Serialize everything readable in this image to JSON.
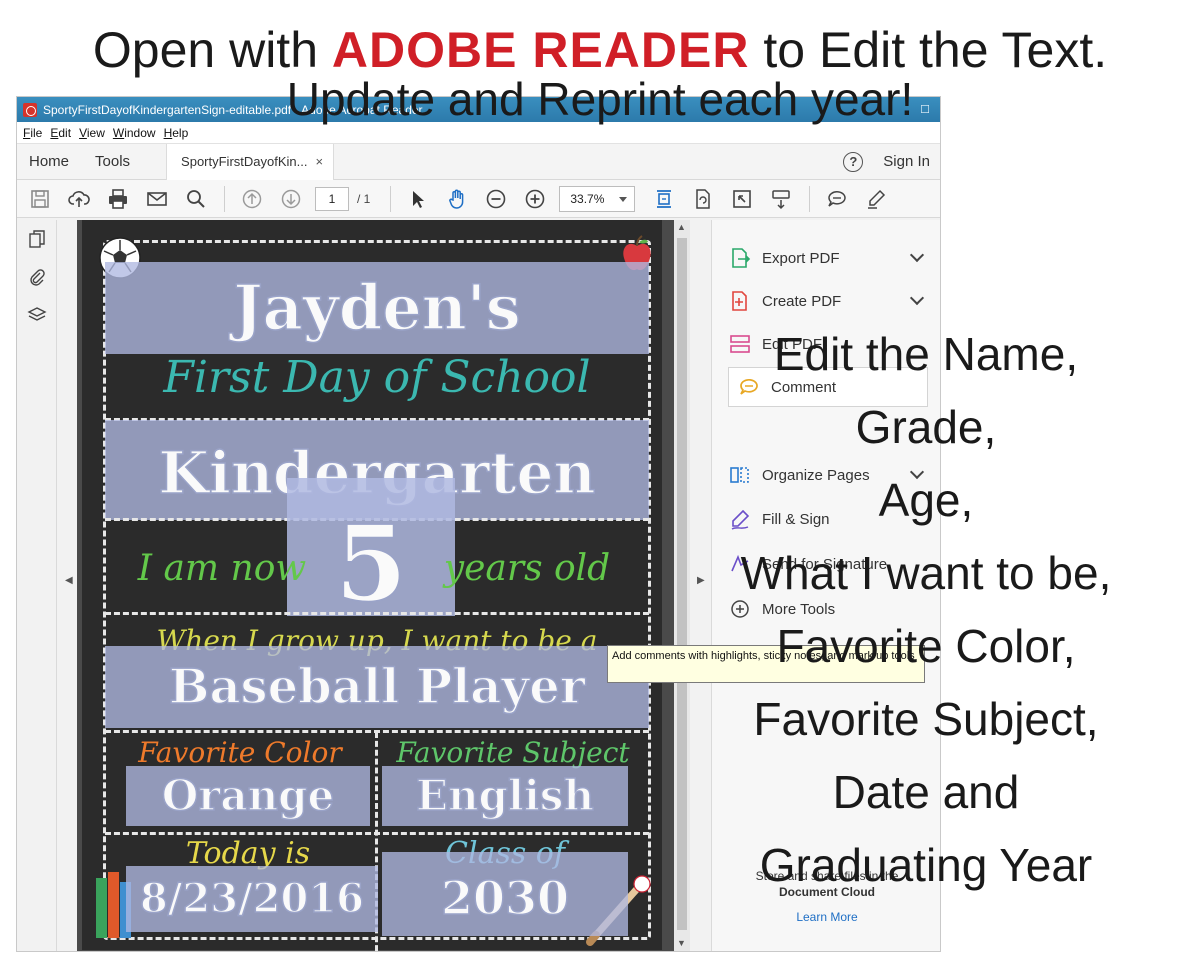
{
  "headline": {
    "line1_prefix": "Open with ",
    "line1_brand": "ADOBE READER",
    "line1_suffix": " to Edit the Text.",
    "line2": "Update and Reprint each year!"
  },
  "window": {
    "title": "SportyFirstDayofKindergartenSign-editable.pdf - Adobe Acrobat Reader",
    "menus": [
      "File",
      "Edit",
      "View",
      "Window",
      "Help"
    ],
    "nav_tabs": [
      "Home",
      "Tools"
    ],
    "doc_tab": "SportyFirstDayofKin...",
    "doc_tab_close": "×",
    "help": "?",
    "sign_in": "Sign In"
  },
  "toolbar": {
    "page_current": "1",
    "page_total": "/ 1",
    "zoom": "33.7%"
  },
  "tools_pane": {
    "items": [
      "Export PDF",
      "Create PDF",
      "Edit PDF",
      "Comment",
      "Organize Pages",
      "Fill & Sign",
      "Send for Signature",
      "More Tools"
    ],
    "tooltip": "Add comments with highlights, sticky notes, and mark up tools",
    "cloud_line1": "Store and share files in the",
    "cloud_line2": "Document Cloud",
    "learn_more": "Learn More"
  },
  "sign": {
    "name": "Jayden's",
    "subtitle": "First Day of School",
    "grade": "Kindergarten",
    "age_prefix": "I am now",
    "age": "5",
    "age_suffix": "years old",
    "grow_up_label": "When I grow up, I want to be a",
    "career": "Baseball Player",
    "color_label": "Favorite Color",
    "color_value": "Orange",
    "subject_label": "Favorite Subject",
    "subject_value": "English",
    "today_label": "Today is",
    "date": "8/23/2016",
    "class_label": "Class of",
    "class_year": "2030",
    "colors": {
      "subtitle": "#3bb8b0",
      "age_text": "#63c84a",
      "grow_up": "#d6d84e",
      "color_label": "#ee7a2b",
      "subject_label": "#5ec66a",
      "today": "#e6d84a",
      "class_label": "#6fc4d8"
    }
  },
  "annotation": {
    "lines": [
      "Edit the Name,",
      "Grade,",
      "Age,",
      "What I want to be,",
      "Favorite Color,",
      "Favorite Subject,",
      "Date and",
      "Graduating Year"
    ]
  },
  "colors": {
    "brand_red": "#d01f27",
    "chalkboard": "#2b2b2b",
    "field_highlight": "#afb9e1",
    "acrobat_blue": "#2c7aab"
  }
}
